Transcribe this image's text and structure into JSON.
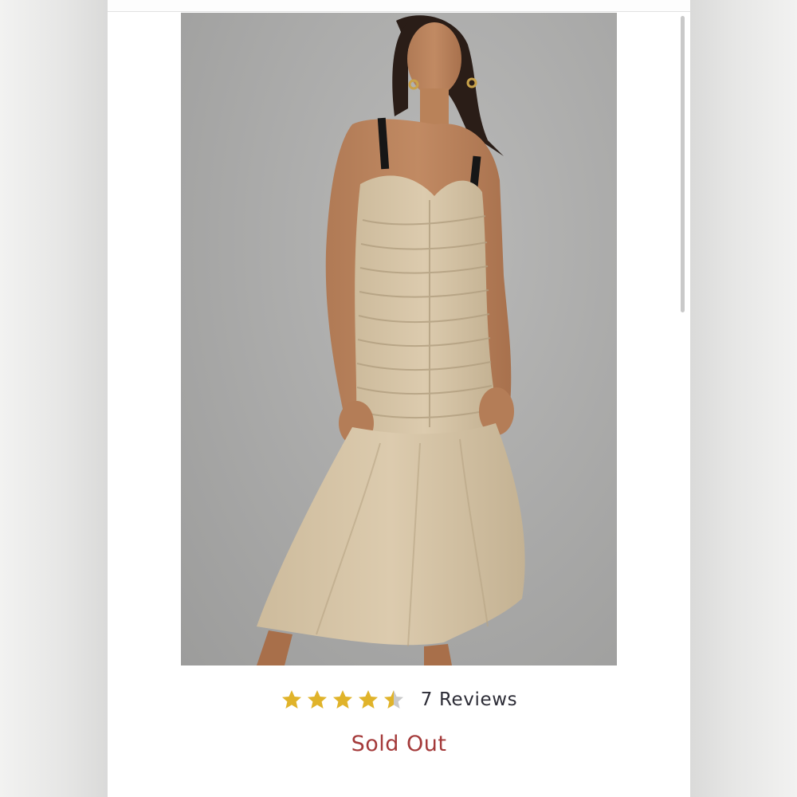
{
  "product": {
    "image_alt": "Model wearing a beige ruched midi dress with black straps",
    "rating": {
      "value": 4.5,
      "max": 5,
      "star_color": "#e0b32a",
      "empty_star_color": "#c9c9c9"
    },
    "reviews_label": "7 Reviews",
    "availability": "Sold Out",
    "availability_color": "#a43a3a"
  }
}
